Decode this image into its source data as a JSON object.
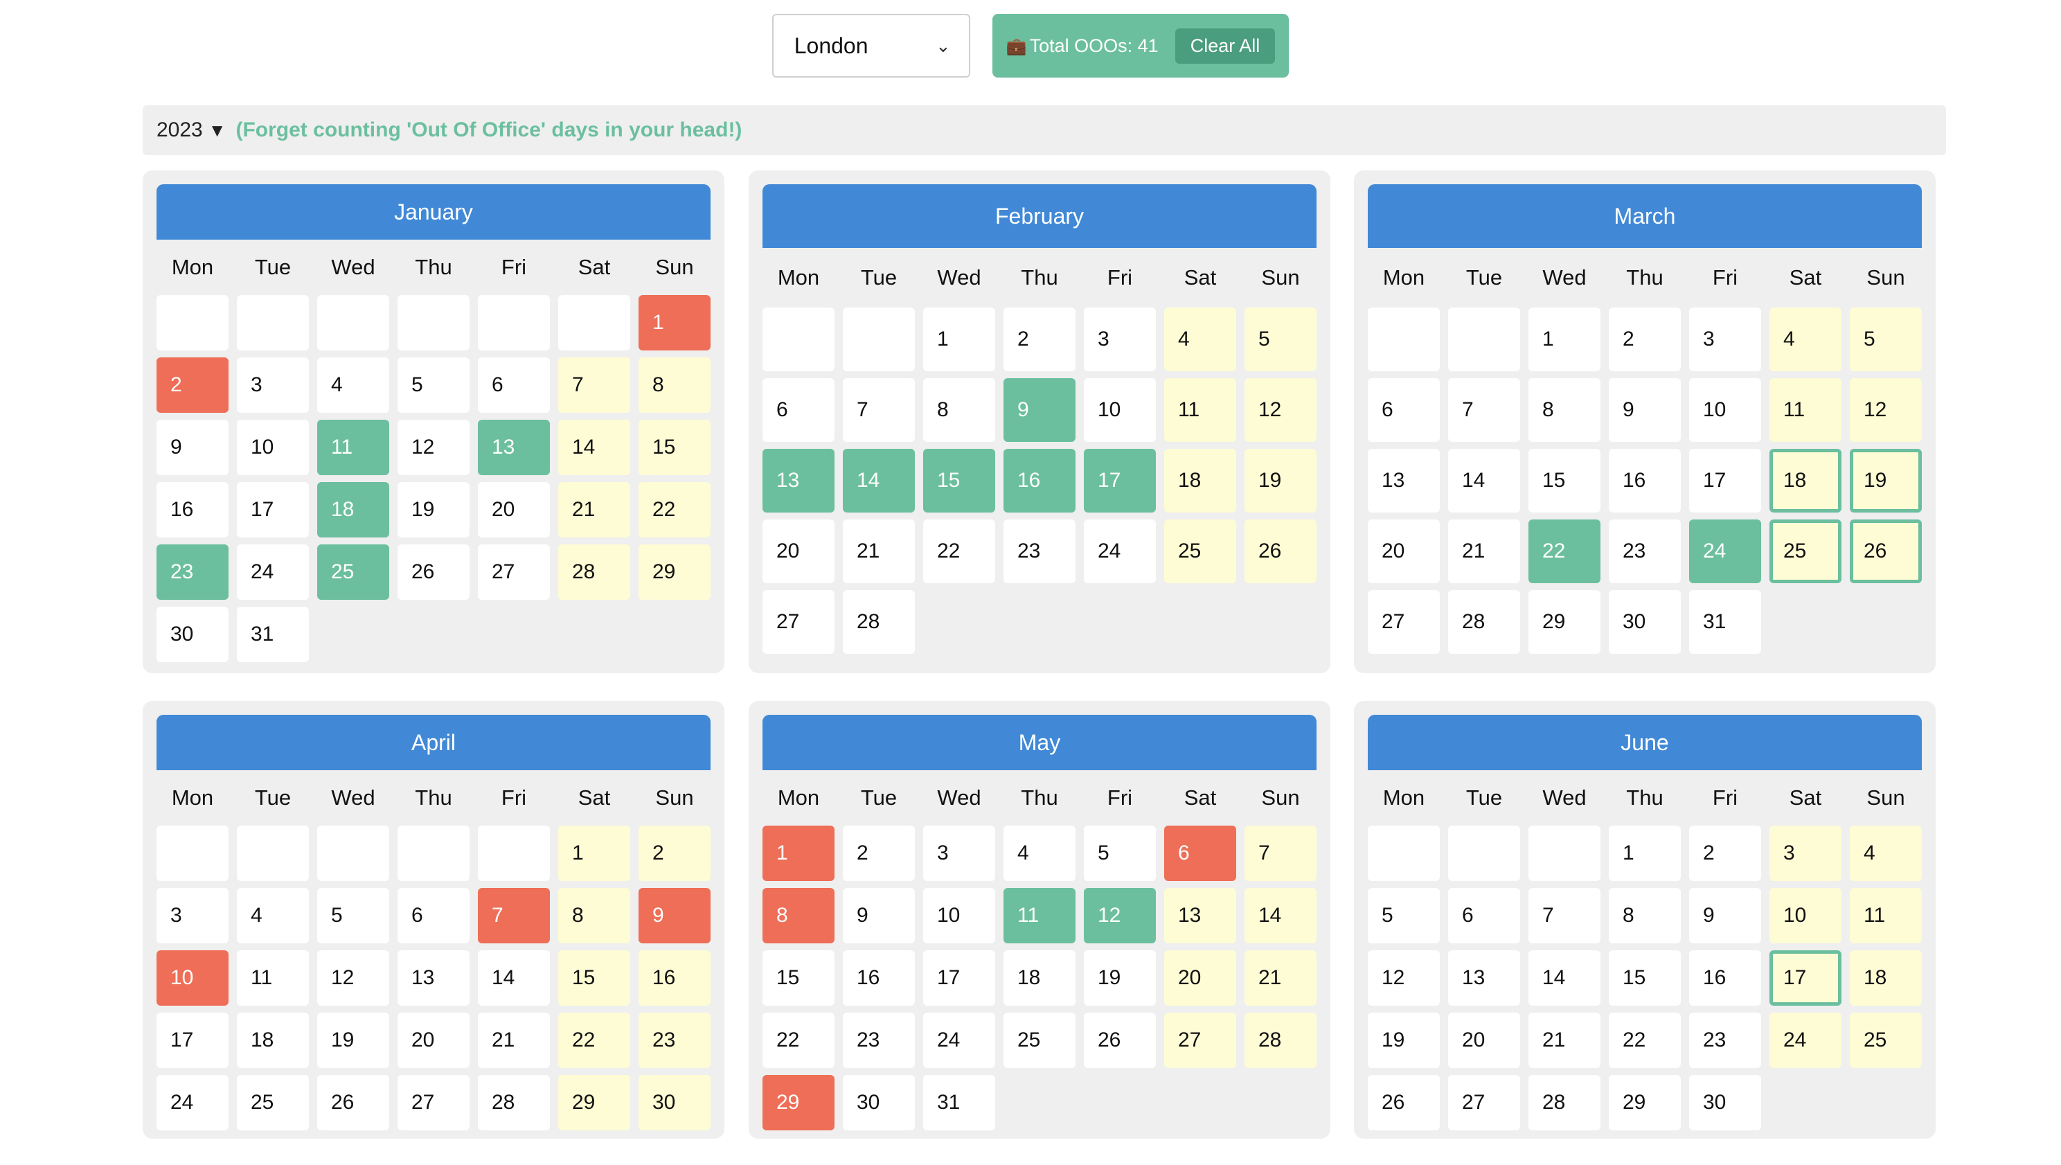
{
  "toolbar": {
    "city_value": "London",
    "total_label": "Total OOOs: 41",
    "clear_label": "Clear All",
    "brief_icon": "briefcase-icon"
  },
  "yearbar": {
    "year": "2023",
    "toggle_symbol": "▼",
    "tagline": "(Forget counting 'Out Of Office' days in your head!)"
  },
  "weekdays": [
    "Mon",
    "Tue",
    "Wed",
    "Thu",
    "Fri",
    "Sat",
    "Sun"
  ],
  "colors": {
    "header": "#4189d6",
    "ooo": "#6bbf9f",
    "holiday": "#ee6e57",
    "weekend": "#fefcd5",
    "card_bg": "#efefef"
  },
  "months": [
    {
      "name": "January",
      "offset": 6,
      "days": 31,
      "ooo": [
        11,
        13,
        18,
        23,
        25
      ],
      "holidays": [
        1,
        2
      ],
      "outlined": []
    },
    {
      "name": "February",
      "offset": 2,
      "days": 28,
      "ooo": [
        9,
        13,
        14,
        15,
        16,
        17
      ],
      "holidays": [],
      "outlined": []
    },
    {
      "name": "March",
      "offset": 2,
      "days": 31,
      "ooo": [
        22,
        24
      ],
      "holidays": [],
      "outlined": [
        18,
        19,
        25,
        26
      ]
    },
    {
      "name": "April",
      "offset": 5,
      "days": 30,
      "ooo": [],
      "holidays": [
        7,
        9,
        10
      ],
      "outlined": []
    },
    {
      "name": "May",
      "offset": 0,
      "days": 31,
      "ooo": [
        11,
        12
      ],
      "holidays": [
        1,
        6,
        8,
        29
      ],
      "outlined": []
    },
    {
      "name": "June",
      "offset": 3,
      "days": 30,
      "ooo": [],
      "holidays": [],
      "outlined": [
        17
      ]
    }
  ]
}
